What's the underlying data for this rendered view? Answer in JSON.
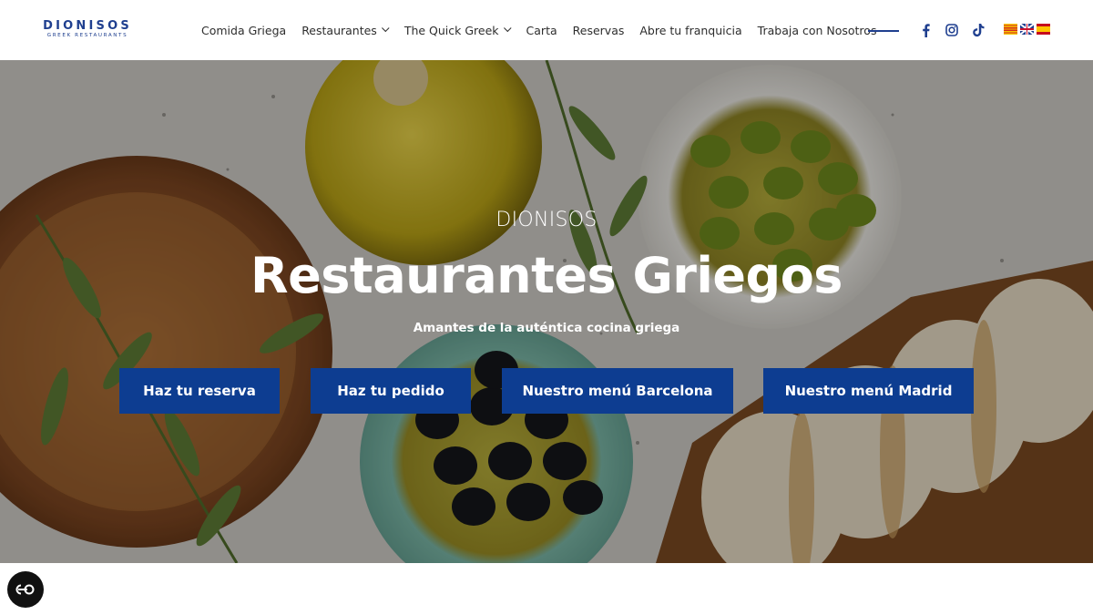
{
  "brand": {
    "logo_main": "DIONISOS",
    "logo_sub": "GREEK RESTAURANTS",
    "color": "#1f3f8f"
  },
  "nav": {
    "items": [
      {
        "label": "Comida Griega",
        "dropdown": false
      },
      {
        "label": "Restaurantes",
        "dropdown": true
      },
      {
        "label": "The Quick Greek",
        "dropdown": true
      },
      {
        "label": "Carta",
        "dropdown": false
      },
      {
        "label": "Reservas",
        "dropdown": false
      },
      {
        "label": "Abre tu franquicia",
        "dropdown": false
      },
      {
        "label": "Trabaja con Nosotros",
        "dropdown": false
      }
    ],
    "social_icons": [
      "facebook-icon",
      "instagram-icon",
      "tiktok-icon"
    ],
    "languages": [
      "ca",
      "en",
      "es"
    ]
  },
  "hero": {
    "kicker": "DIONISOS",
    "title": "Restaurantes Griegos",
    "subtitle": "Amantes de la auténtica cocina griega",
    "buttons": [
      {
        "label": "Haz tu reserva"
      },
      {
        "label": "Haz tu pedido"
      },
      {
        "label": "Nuestro menú Barcelona"
      },
      {
        "label": "Nuestro menú Madrid"
      }
    ],
    "button_color": "#0d3d91"
  },
  "accessibility": {
    "icon": "accessibility-toggle-icon"
  }
}
